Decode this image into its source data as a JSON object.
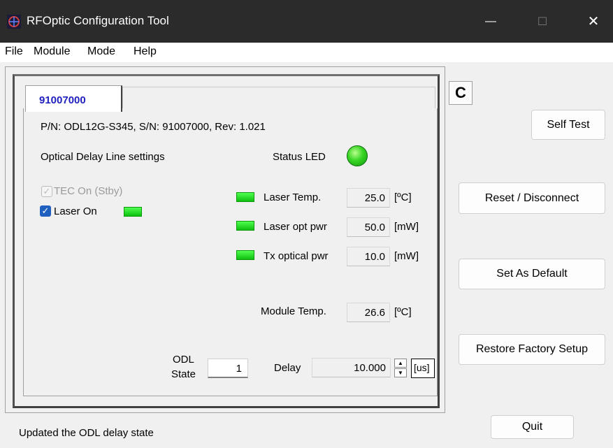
{
  "window": {
    "title": "RFOptic Configuration Tool",
    "minimize": "—",
    "maximize": "☐",
    "close": "✕"
  },
  "menu": [
    "File",
    "Module",
    "Mode",
    "Help"
  ],
  "tab": {
    "label": "91007000"
  },
  "module": {
    "info": "P/N: ODL12G-S345, S/N: 91007000, Rev: 1.021",
    "section_title": "Optical Delay Line settings",
    "status_led_label": "Status LED",
    "status_led_color": "#2fcf20",
    "tec_label": "TEC On (Stby)",
    "tec_checked": true,
    "tec_enabled": false,
    "laser_label": "Laser On",
    "laser_checked": true
  },
  "readings": [
    {
      "label": "Laser Temp.",
      "value": "25.0",
      "unit": "[ºC]"
    },
    {
      "label": "Laser opt pwr",
      "value": "50.0",
      "unit": "[mW]"
    },
    {
      "label": "Tx optical pwr",
      "value": "10.0",
      "unit": "[mW]"
    },
    {
      "label": "Module Temp.",
      "value": "26.6",
      "unit": "[ºC]"
    }
  ],
  "odl": {
    "state_label_line1": "ODL",
    "state_label_line2": "State",
    "state_value": "1",
    "delay_label": "Delay",
    "delay_value": "10.000",
    "delay_unit": "[us]"
  },
  "buttons": {
    "refresh": "C",
    "self_test": "Self Test",
    "reset": "Reset / Disconnect",
    "set_default": "Set As Default",
    "restore": "Restore Factory Setup",
    "quit": "Quit"
  },
  "status": {
    "message": "Updated the ODL delay state"
  },
  "colors": {
    "led_green": "#22d022",
    "tab_text": "#1f1fbf",
    "titlebar": "#2b2b2b"
  }
}
